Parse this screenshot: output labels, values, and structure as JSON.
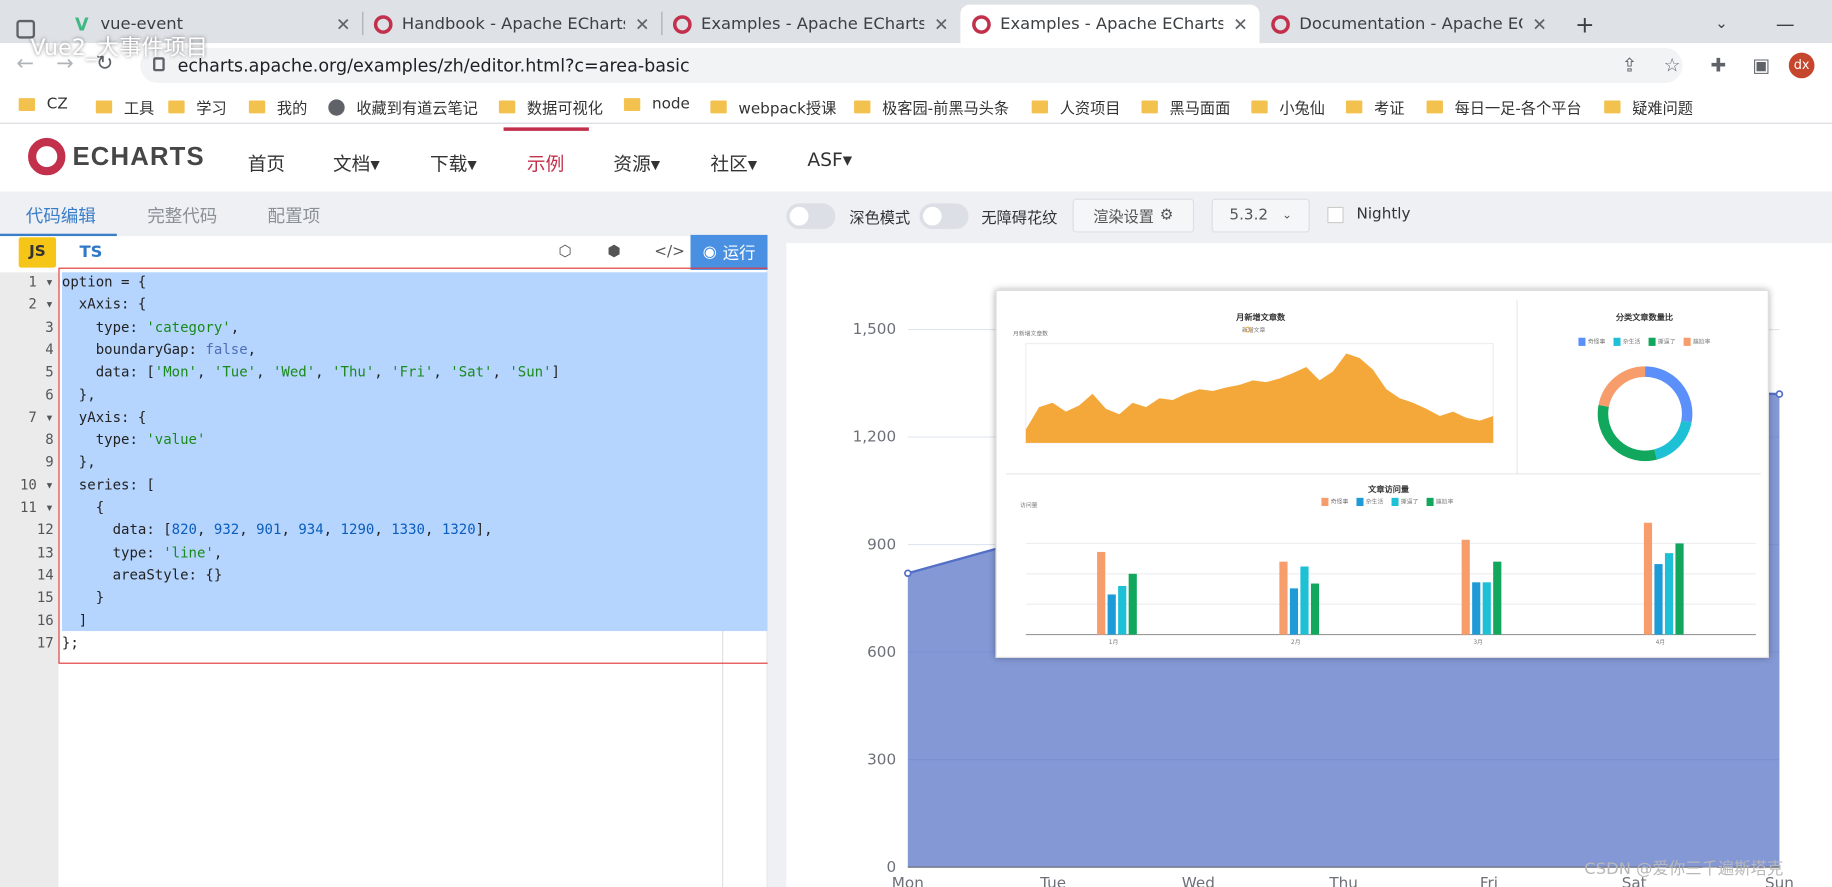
{
  "overlay": {
    "title": "Vue2_大事件项目"
  },
  "tabs": [
    {
      "label": "vue-event",
      "icon": "vue-icon"
    },
    {
      "label": "Handbook - Apache ECharts",
      "icon": "echarts-icon"
    },
    {
      "label": "Examples - Apache ECharts",
      "icon": "echarts-icon"
    },
    {
      "label": "Examples - Apache ECharts",
      "icon": "echarts-icon"
    },
    {
      "label": "Documentation - Apache ECha",
      "icon": "echarts-icon"
    }
  ],
  "address": {
    "url": "echarts.apache.org/examples/zh/editor.html?c=area-basic",
    "avatar": "dx"
  },
  "bookmarks": [
    "CZ",
    "工具",
    "学习",
    "我的",
    "收藏到有道云笔记",
    "数据可视化",
    "node",
    "webpack授课",
    "极客园-前黑马头条",
    "人资项目",
    "黑马面面",
    "小兔仙",
    "考证",
    "每日一足-各个平台",
    "疑难问题"
  ],
  "site": {
    "logo": "ECHARTS",
    "menu": [
      "首页",
      "文档▾",
      "下载▾",
      "示例",
      "资源▾",
      "社区▾",
      "ASF▾"
    ],
    "active_menu": "示例"
  },
  "editor": {
    "tabs": [
      "代码编辑",
      "完整代码",
      "配置项"
    ],
    "lang_js": "JS",
    "lang_ts": "TS",
    "run": "运行",
    "line_numbers": [
      "1",
      "2",
      "3",
      "4",
      "5",
      "6",
      "7",
      "8",
      "9",
      "10",
      "11",
      "12",
      "13",
      "14",
      "15",
      "16",
      "17"
    ],
    "code_lines": [
      "option = {",
      "  xAxis: {",
      "    type: 'category',",
      "    boundaryGap: false,",
      "    data: ['Mon', 'Tue', 'Wed', 'Thu', 'Fri', 'Sat', 'Sun']",
      "  },",
      "  yAxis: {",
      "    type: 'value'",
      "  },",
      "  series: [",
      "    {",
      "      data: [820, 932, 901, 934, 1290, 1330, 1320],",
      "      type: 'line',",
      "      areaStyle: {}",
      "    }",
      "  ]",
      "};"
    ]
  },
  "toolbar": {
    "dark_mode": "深色模式",
    "aria": "无障碍花纹",
    "render_settings": "渲染设置",
    "version": "5.3.2",
    "nightly": "Nightly"
  },
  "chart_data": {
    "type": "area",
    "categories": [
      "Mon",
      "Tue",
      "Wed",
      "Thu",
      "Fri",
      "Sat",
      "Sun"
    ],
    "values": [
      820,
      932,
      901,
      934,
      1290,
      1330,
      1320
    ],
    "y_ticks": [
      "0",
      "300",
      "600",
      "900",
      "1,200",
      "1,500"
    ],
    "ylim": [
      0,
      1500
    ],
    "color": "#5470c6"
  },
  "popup": {
    "line_title": "月新增文章数",
    "line_legend": "新增文章",
    "line_ylabel": "月新增文章数",
    "pie_title": "分类文章数量比",
    "pie_legend": [
      "奇怪事",
      "杂生活",
      "撕逼了",
      "尴尬率"
    ],
    "bar_title": "文章访问量",
    "bar_legend": [
      "奇怪事",
      "杂生活",
      "撕逼了",
      "尴尬率"
    ],
    "bar_ylabel": "访问量",
    "bar_categories": [
      "1月",
      "2月",
      "3月",
      "4月"
    ]
  },
  "watermark": "CSDN @爱你三千遍斯塔克"
}
